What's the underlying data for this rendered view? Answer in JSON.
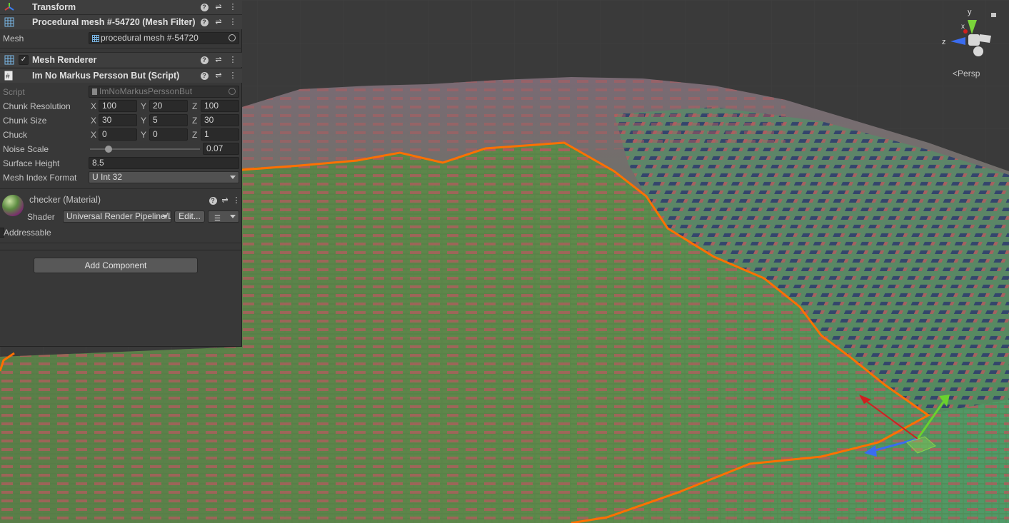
{
  "inspector": {
    "transform": {
      "title": "Transform"
    },
    "mesh_filter": {
      "title": "Procedural mesh #-54720 (Mesh Filter)",
      "mesh_label": "Mesh",
      "mesh_value": "procedural mesh #-54720"
    },
    "mesh_renderer": {
      "title": "Mesh Renderer",
      "enabled": true
    },
    "script_component": {
      "title": "Im No Markus Persson But (Script)",
      "script_label": "Script",
      "script_value": "ImNoMarkusPerssonBut",
      "chunk_resolution": {
        "label": "Chunk Resolution",
        "x": "100",
        "y": "20",
        "z": "100"
      },
      "chunk_size": {
        "label": "Chunk Size",
        "x": "30",
        "y": "5",
        "z": "30"
      },
      "chuck": {
        "label": "Chuck",
        "x": "0",
        "y": "0",
        "z": "1"
      },
      "noise_scale": {
        "label": "Noise Scale",
        "value": "0.07",
        "slider_fraction": 0.17
      },
      "surface_height": {
        "label": "Surface Height",
        "value": "8.5"
      },
      "mesh_index_format": {
        "label": "Mesh Index Format",
        "value": "U Int 32"
      },
      "axis_labels": {
        "x": "X",
        "y": "Y",
        "z": "Z"
      }
    },
    "material": {
      "title": "checker (Material)",
      "shader_label": "Shader",
      "shader_value": "Universal Render Pipeline/Lit",
      "edit_label": "Edit..."
    },
    "addressable_label": "Addressable",
    "add_component_label": "Add Component",
    "icons": {
      "help": "?",
      "preset": "⇌",
      "more": "⋮"
    }
  },
  "scene": {
    "view_mode": "Persp",
    "gizmo_axes": {
      "x": "x",
      "y": "y",
      "z": "z"
    },
    "colors": {
      "terrain_green": "#5f8a4a",
      "terrain_red": "#b45b5e",
      "terrain_blue": "#2d3a6e",
      "selection_outline": "#ff7000",
      "background": "#3a3a3a"
    }
  }
}
